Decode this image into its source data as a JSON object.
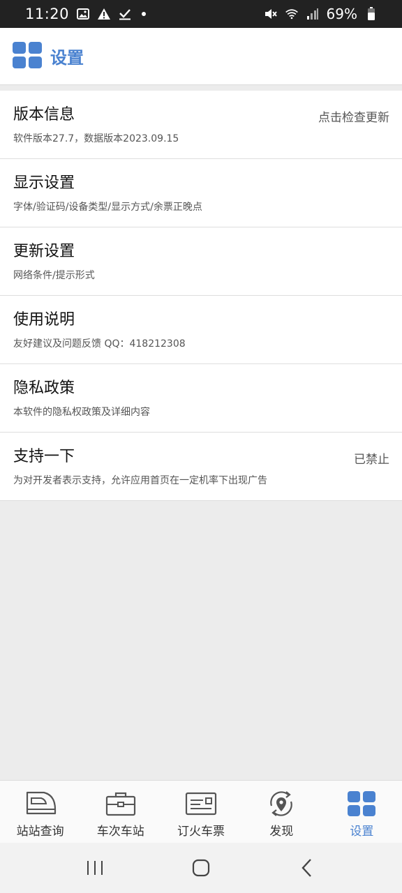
{
  "status_bar": {
    "time": "11:20",
    "battery": "69%",
    "icons": [
      "image-icon",
      "warning-icon",
      "check-icon",
      "dot-icon",
      "mute-icon",
      "wifi-icon",
      "signal-icon",
      "battery-icon"
    ]
  },
  "app_bar": {
    "title": "设置",
    "icon": "grid-icon",
    "accent_color": "#4a82d0"
  },
  "settings": [
    {
      "title": "版本信息",
      "subtitle": "软件版本27.7，数据版本2023.09.15",
      "right": "点击检查更新"
    },
    {
      "title": "显示设置",
      "subtitle": "字体/验证码/设备类型/显示方式/余票正晚点",
      "right": ""
    },
    {
      "title": "更新设置",
      "subtitle": "网络条件/提示形式",
      "right": ""
    },
    {
      "title": "使用说明",
      "subtitle": "友好建议及问题反馈 QQ：418212308",
      "right": ""
    },
    {
      "title": "隐私政策",
      "subtitle": "本软件的隐私权政策及详细内容",
      "right": ""
    },
    {
      "title": "支持一下",
      "subtitle": "为对开发者表示支持，允许应用首页在一定机率下出现广告",
      "right": "已禁止"
    }
  ],
  "tabs": [
    {
      "label": "站站查询",
      "icon": "train-icon",
      "active": false
    },
    {
      "label": "车次车站",
      "icon": "briefcase-icon",
      "active": false
    },
    {
      "label": "订火车票",
      "icon": "ticket-icon",
      "active": false
    },
    {
      "label": "发现",
      "icon": "location-refresh-icon",
      "active": false
    },
    {
      "label": "设置",
      "icon": "grid-icon",
      "active": true
    }
  ],
  "nav_bar": {
    "buttons": [
      "recents-icon",
      "home-icon",
      "back-icon"
    ]
  }
}
